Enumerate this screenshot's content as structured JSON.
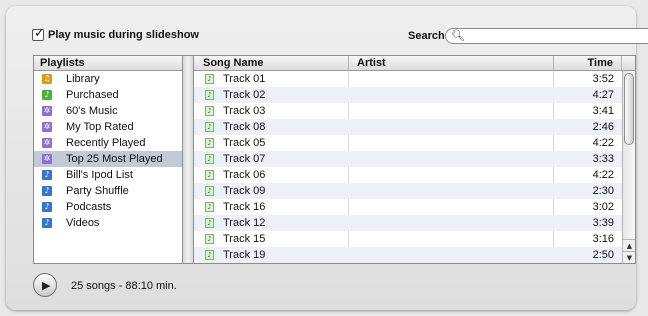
{
  "topbar": {
    "checkbox_label": "Play music during slideshow",
    "checkbox_checked": true,
    "search_label": "Search:",
    "search_value": ""
  },
  "playlists": {
    "header": "Playlists",
    "items": [
      {
        "label": "Library",
        "icon": "library-icon",
        "selected": false
      },
      {
        "label": "Purchased",
        "icon": "purchased-icon",
        "selected": false
      },
      {
        "label": "60's Music",
        "icon": "smart-playlist-icon",
        "selected": false
      },
      {
        "label": "My Top Rated",
        "icon": "smart-playlist-icon",
        "selected": false
      },
      {
        "label": "Recently Played",
        "icon": "smart-playlist-icon",
        "selected": false
      },
      {
        "label": "Top 25 Most Played",
        "icon": "smart-playlist-icon",
        "selected": true
      },
      {
        "label": "Bill's Ipod List",
        "icon": "playlist-icon",
        "selected": false
      },
      {
        "label": "Party Shuffle",
        "icon": "playlist-icon",
        "selected": false
      },
      {
        "label": "Podcasts",
        "icon": "playlist-icon",
        "selected": false
      },
      {
        "label": "Videos",
        "icon": "playlist-icon",
        "selected": false
      }
    ]
  },
  "songs": {
    "columns": {
      "song": "Song Name",
      "artist": "Artist",
      "time": "Time"
    },
    "rows": [
      {
        "name": "Track 01",
        "artist": "",
        "time": "3:52"
      },
      {
        "name": "Track 02",
        "artist": "",
        "time": "4:27"
      },
      {
        "name": "Track 03",
        "artist": "",
        "time": "3:41"
      },
      {
        "name": "Track 08",
        "artist": "",
        "time": "2:46"
      },
      {
        "name": "Track 05",
        "artist": "",
        "time": "4:22"
      },
      {
        "name": "Track 07",
        "artist": "",
        "time": "3:33"
      },
      {
        "name": "Track 06",
        "artist": "",
        "time": "4:22"
      },
      {
        "name": "Track 09",
        "artist": "",
        "time": "2:30"
      },
      {
        "name": "Track 16",
        "artist": "",
        "time": "3:02"
      },
      {
        "name": "Track 12",
        "artist": "",
        "time": "3:39"
      },
      {
        "name": "Track 15",
        "artist": "",
        "time": "3:16"
      },
      {
        "name": "Track 19",
        "artist": "",
        "time": "2:50"
      }
    ]
  },
  "footer": {
    "status": "25 songs - 88:10 min."
  },
  "colors": {
    "selection": "#c3c9d5",
    "stripe": "#edf0f5"
  }
}
